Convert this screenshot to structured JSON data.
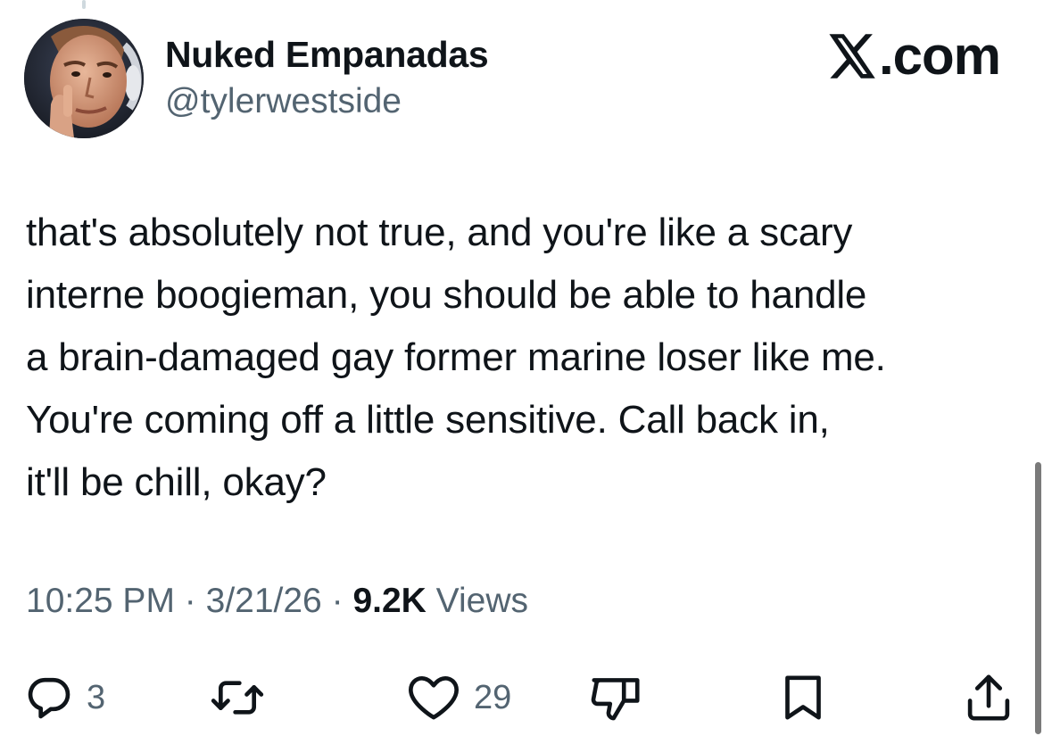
{
  "author": {
    "display_name": "Nuked Empanadas",
    "handle": "@tylerwestside"
  },
  "brand": {
    "label": ".com",
    "icon": "x-logo-icon"
  },
  "tweet": {
    "lines": [
      "that's absolutely not true, and you're like a scary",
      "interne boogieman, you should be able to handle",
      "a brain-damaged gay former marine loser like me.",
      "You're coming off a little sensitive. Call back in,",
      "it'll be chill, okay?"
    ],
    "time": "10:25 PM",
    "separator": "·",
    "date": "3/21/26",
    "views_count": "9.2K",
    "views_label": "Views"
  },
  "actions": {
    "reply_count": "3",
    "retweet_count": "",
    "like_count": "29"
  },
  "icons": [
    "reply-icon",
    "retweet-icon",
    "like-icon",
    "dislike-icon",
    "bookmark-icon",
    "share-icon"
  ],
  "colors": {
    "text": "#0f1419",
    "secondary": "#536471"
  }
}
